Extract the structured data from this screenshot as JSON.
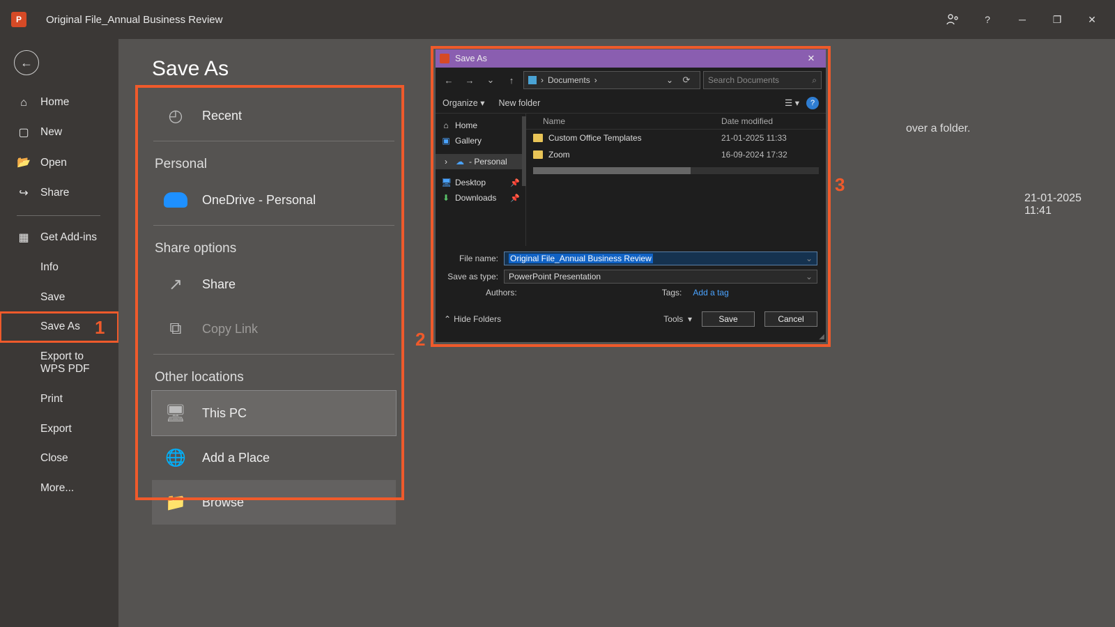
{
  "titlebar": {
    "app_abbrev": "P",
    "doc_title": "Original File_Annual Business Review"
  },
  "side_nav": {
    "home": "Home",
    "new": "New",
    "open": "Open",
    "share": "Share",
    "get_addins": "Get Add-ins",
    "info": "Info",
    "save": "Save",
    "save_as": "Save As",
    "export_wps": "Export to WPS PDF",
    "print": "Print",
    "export": "Export",
    "close": "Close",
    "more": "More..."
  },
  "center": {
    "heading": "Save As",
    "recent": "Recent",
    "personal_label": "Personal",
    "onedrive": "OneDrive - Personal",
    "share_options_label": "Share options",
    "share": "Share",
    "copy_link": "Copy Link",
    "other_locations_label": "Other locations",
    "this_pc": "This PC",
    "add_place": "Add a Place",
    "browse": "Browse"
  },
  "right": {
    "hint_suffix": "over a folder.",
    "timestamp": "21-01-2025 11:41"
  },
  "dialog": {
    "title": "Save As",
    "breadcrumb": "Documents",
    "search_placeholder": "Search Documents",
    "organize": "Organize",
    "new_folder": "New folder",
    "tree": {
      "home": "Home",
      "gallery": "Gallery",
      "personal": "- Personal",
      "desktop": "Desktop",
      "downloads": "Downloads"
    },
    "columns": {
      "name": "Name",
      "date": "Date modified"
    },
    "rows": [
      {
        "name": "Custom Office Templates",
        "date": "21-01-2025 11:33"
      },
      {
        "name": "Zoom",
        "date": "16-09-2024 17:32"
      }
    ],
    "file_name_label": "File name:",
    "file_name_value": "Original File_Annual Business Review",
    "save_type_label": "Save as type:",
    "save_type_value": "PowerPoint Presentation",
    "authors_label": "Authors:",
    "tags_label": "Tags:",
    "add_tag": "Add a tag",
    "hide_folders": "Hide Folders",
    "tools": "Tools",
    "save_btn": "Save",
    "cancel_btn": "Cancel"
  },
  "annotations": {
    "one": "1",
    "two": "2",
    "three": "3"
  }
}
